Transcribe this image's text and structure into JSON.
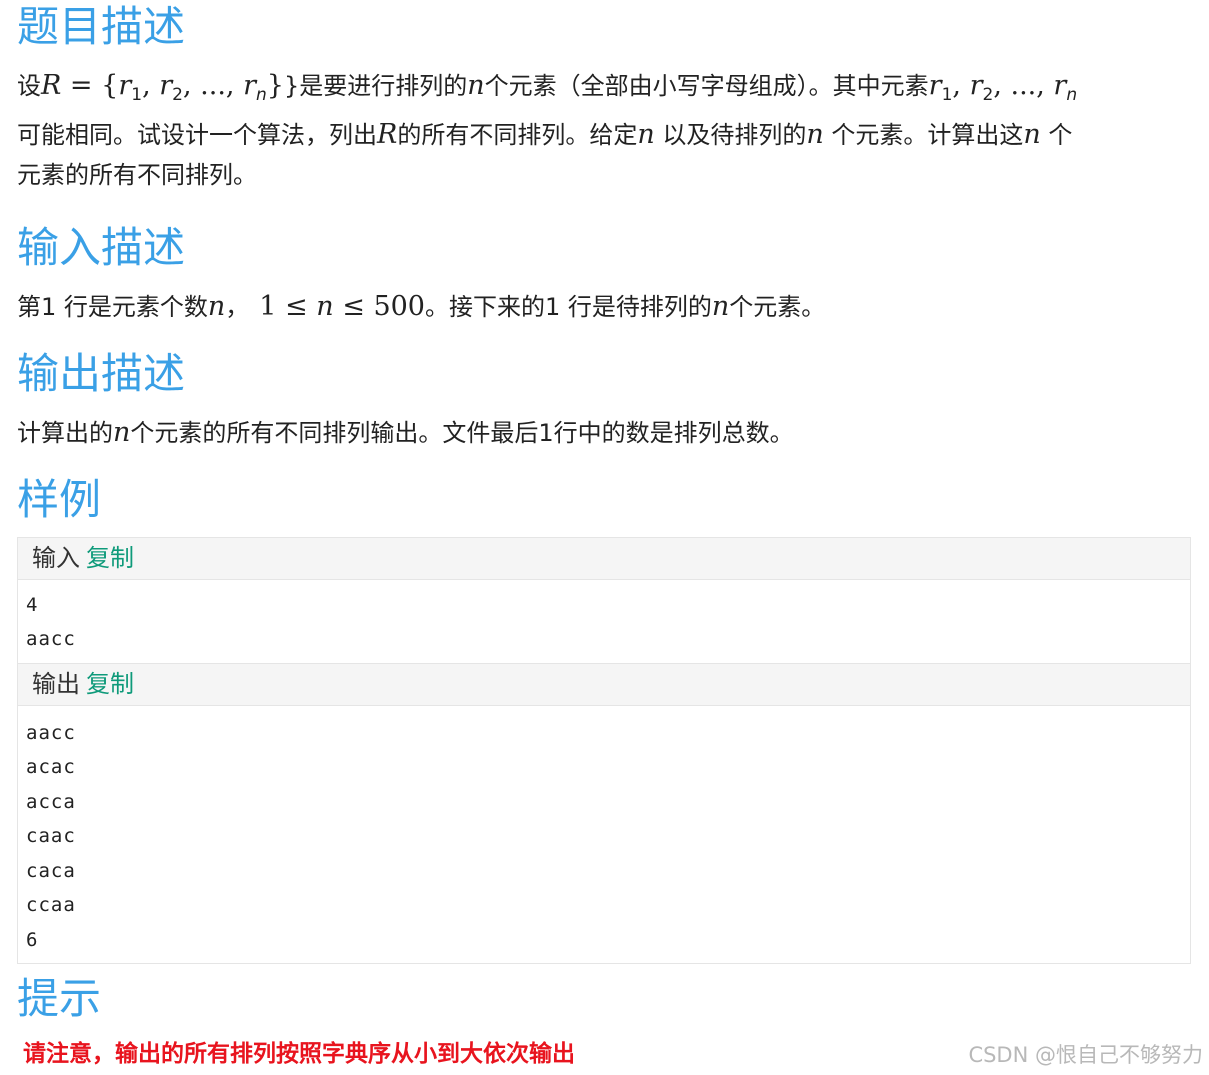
{
  "sections": {
    "description_title": "题目描述",
    "input_title": "输入描述",
    "output_title": "输出描述",
    "sample_title": "样例",
    "hint_title": "提示"
  },
  "description": {
    "l1_a": "设",
    "l1_math": "R = {r",
    "l1_b": "}是要进行排列的",
    "l1_c": "个元素（全部由小写字母组成）。其中元素",
    "l2_a": "可能相同。试设计一个算法，列出",
    "l2_b": "的所有不同排列。给定",
    "l2_c": " 以及待排列的",
    "l2_d": " 个元素。计算出这",
    "l2_e": " 个",
    "l3": "元素的所有不同排列。",
    "var_R": "R",
    "var_n": "n",
    "var_r": "r",
    "sub_1": "1",
    "sub_2": "2",
    "sub_n": "n",
    "comma": ", ",
    "dots": "...",
    "set_open": " = {",
    "set_close": "}"
  },
  "input_desc": {
    "a": "第1 行是元素个数",
    "b": "，",
    "range_1": "1 ≤ ",
    "range_2": " ≤ 500",
    "c": "。接下来的1 行是待排列的",
    "d": "个元素。"
  },
  "output_desc": {
    "a": "计算出的",
    "b": "个元素的所有不同排列输出。文件最后1行中的数是排列总数。"
  },
  "sample": {
    "input_label": "输入",
    "output_label": "输出",
    "copy_label": "复制",
    "input_lines": [
      "4",
      "aacc"
    ],
    "output_lines": [
      "aacc",
      "acac",
      "acca",
      "caac",
      "caca",
      "ccaa",
      "6"
    ]
  },
  "hint_text": "请注意，输出的所有排列按照字典序从小到大依次输出",
  "watermark": "CSDN @恨自己不够努力",
  "colors": {
    "heading": "#3aa0e6",
    "copy_link": "#0e9a7a",
    "hint": "#e8141e"
  }
}
